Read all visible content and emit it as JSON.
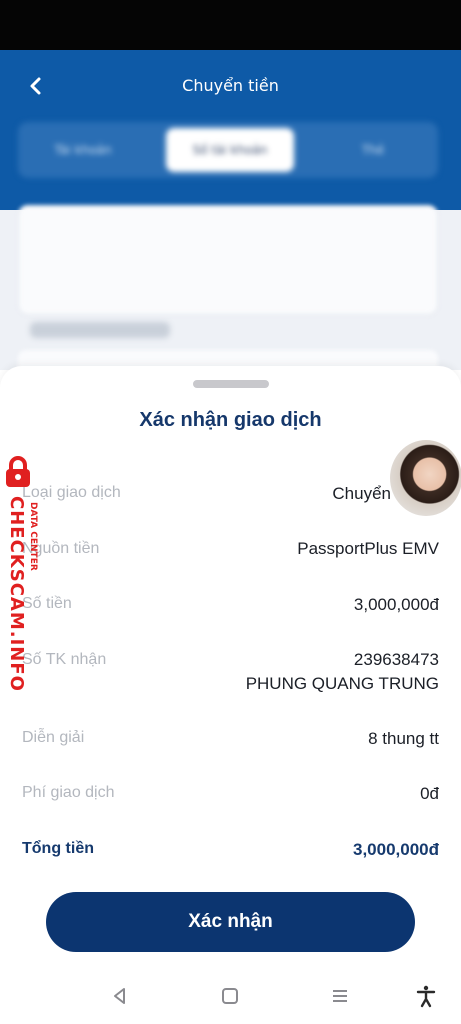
{
  "header": {
    "title": "Chuyển tiền",
    "tabs": [
      "Tài khoản",
      "Số tài khoản",
      "Thẻ"
    ]
  },
  "sheet": {
    "title": "Xác nhận giao dịch",
    "rows": [
      {
        "label": "Loại giao dịch",
        "value": "Chuyển"
      },
      {
        "label": "Nguồn tiền",
        "value": "PassportPlus EMV"
      },
      {
        "label": "Số tiền",
        "value": "3,000,000đ"
      },
      {
        "label": "Số TK nhận",
        "value": "239638473",
        "value2": "PHUNG QUANG TRUNG"
      },
      {
        "label": "Diễn giải",
        "value": "8 thung tt"
      },
      {
        "label": "Phí giao dịch",
        "value": "0đ"
      },
      {
        "label": "Tổng tiền",
        "value": "3,000,000đ"
      }
    ],
    "confirm_label": "Xác nhận"
  },
  "watermark": {
    "brand": "CHECKSCAM.INFO",
    "sub": "DATA CENTER"
  },
  "nav": {
    "icons": [
      "back-triangle-icon",
      "home-square-icon",
      "recents-menu-icon",
      "accessibility-icon"
    ]
  },
  "colors": {
    "header_blue": "#0e5aa7",
    "confirm_navy": "#0c3570",
    "title_navy": "#16386b",
    "watermark_red": "#e02020"
  }
}
